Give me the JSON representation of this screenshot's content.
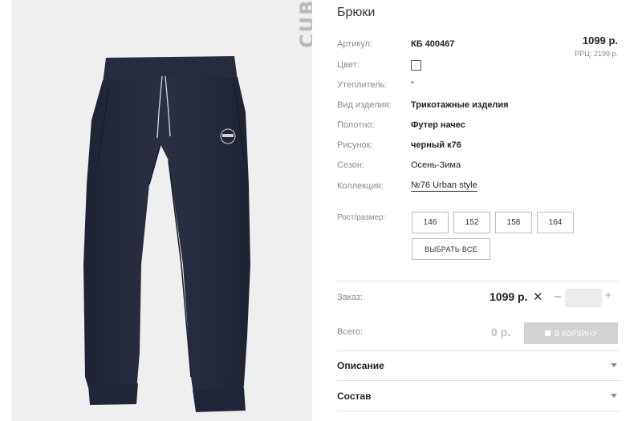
{
  "brand": "CUBBY",
  "product": {
    "title": "Брюки",
    "price": "1099 р.",
    "rrc": "РРЦ: 2199 р."
  },
  "specs": [
    {
      "label": "Артикул:",
      "value": "КБ 400467",
      "style": "bold"
    },
    {
      "label": "Цвет:",
      "value": "",
      "style": "swatch"
    },
    {
      "label": "Утеплитель:",
      "value": "\"",
      "style": "plain"
    },
    {
      "label": "Вид изделия:",
      "value": "Трикотажные изделия",
      "style": "bold"
    },
    {
      "label": "Полотно:",
      "value": "Футер начес",
      "style": "bold"
    },
    {
      "label": "Рисунок:",
      "value": "черный к76",
      "style": "bold"
    },
    {
      "label": "Сезон:",
      "value": "Осень-Зима",
      "style": "plain"
    },
    {
      "label": "Коллекция:",
      "value": "№76 Urban style",
      "style": "link"
    }
  ],
  "sizes": {
    "label": "Рост/размер:",
    "options": [
      "146",
      "152",
      "158",
      "164"
    ],
    "select_all": "ВЫБРАТЬ ВСЕ"
  },
  "order": {
    "label": "Заказ:",
    "price": "1099 р.",
    "times": "✕",
    "minus": "–",
    "plus": "+",
    "quantity": ""
  },
  "total": {
    "label": "Всего:",
    "value": "0 р.",
    "cart_button": "В КОРЗИНУ"
  },
  "accordions": [
    {
      "title": "Описание"
    },
    {
      "title": "Состав"
    }
  ],
  "colors": {
    "pants": "#242a3c",
    "photo_bg": "#efefef",
    "cart_button_bg": "#d2d2d2"
  }
}
